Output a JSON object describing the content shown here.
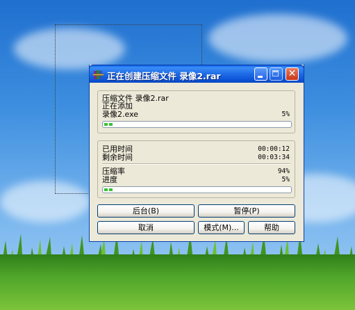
{
  "window": {
    "title": "正在创建压缩文件 录像2.rar",
    "archive_label": "压缩文件 录像2.rar",
    "status_text": "正在添加",
    "current_file": "录像2.exe",
    "file_percent": "5%",
    "file_progress": 0.05,
    "elapsed_label": "已用时间",
    "elapsed_value": "00:00:12",
    "remaining_label": "剩余时间",
    "remaining_value": "00:03:34",
    "ratio_label": "压缩率",
    "ratio_value": "94%",
    "progress_label": "进度",
    "progress_value": "5%",
    "total_progress": 0.05
  },
  "buttons": {
    "background": "后台(B)",
    "pause": "暂停(P)",
    "cancel": "取消",
    "mode": "模式(M)...",
    "help": "帮助"
  },
  "icons": {
    "app": "winrar-books-icon",
    "minimize": "minimize-icon",
    "maximize": "maximize-icon",
    "close": "close-icon"
  },
  "colors": {
    "titlebar": "#0b52d6",
    "progress_fill": "#37c137",
    "close_button": "#c7371a"
  }
}
